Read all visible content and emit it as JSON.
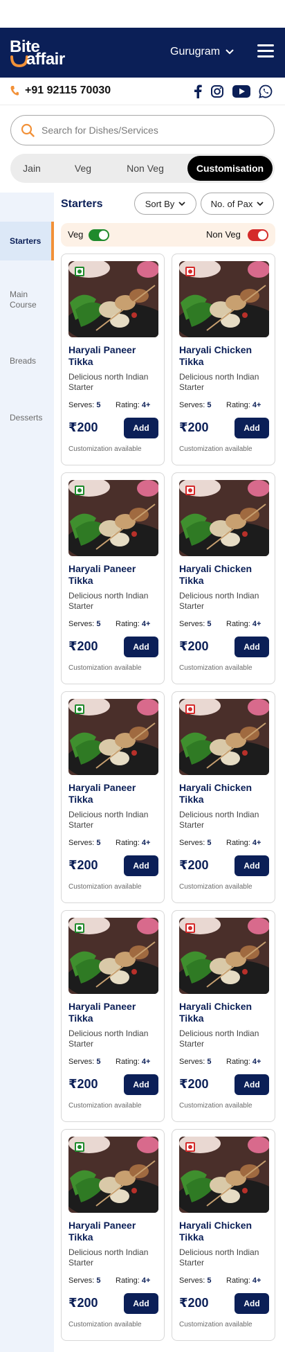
{
  "brand": {
    "line1": "Bite",
    "line2": "affair"
  },
  "header": {
    "city": "Gurugram"
  },
  "contact": {
    "phone": "+91 92115 70030"
  },
  "search": {
    "placeholder": "Search for Dishes/Services"
  },
  "filters": [
    "Jain",
    "Veg",
    "Non Veg",
    "Customisation"
  ],
  "active_filter": "Customisation",
  "sidebar": [
    "Starters",
    "Main Course",
    "Breads",
    "Desserts"
  ],
  "active_category": "Starters",
  "section": {
    "title": "Starters",
    "sort_label": "Sort By",
    "pax_label": "No. of Pax"
  },
  "diet_toggle": {
    "veg_label": "Veg",
    "nonveg_label": "Non Veg",
    "veg_on": true,
    "nonveg_on": true
  },
  "colors": {
    "brand_navy": "#0b1f57",
    "accent_orange": "#f29138",
    "veg_green": "#1f8a2c",
    "nonveg_red": "#d42a2a"
  },
  "cards": [
    {
      "name": "Haryali Paneer Tikka",
      "desc": "Delicious north Indian Starter",
      "serves_label": "Serves:",
      "serves": "5",
      "rating_label": "Rating:",
      "rating": "4+",
      "price": "₹200",
      "add": "Add",
      "note": "Customization available",
      "diet": "veg"
    },
    {
      "name": "Haryali Chicken Tikka",
      "desc": "Delicious north Indian Starter",
      "serves_label": "Serves:",
      "serves": "5",
      "rating_label": "Rating:",
      "rating": "4+",
      "price": "₹200",
      "add": "Add",
      "note": "Customization available",
      "diet": "nonveg"
    },
    {
      "name": "Haryali Paneer Tikka",
      "desc": "Delicious north Indian Starter",
      "serves_label": "Serves:",
      "serves": "5",
      "rating_label": "Rating:",
      "rating": "4+",
      "price": "₹200",
      "add": "Add",
      "note": "Customization available",
      "diet": "veg"
    },
    {
      "name": "Haryali Chicken Tikka",
      "desc": "Delicious north Indian Starter",
      "serves_label": "Serves:",
      "serves": "5",
      "rating_label": "Rating:",
      "rating": "4+",
      "price": "₹200",
      "add": "Add",
      "note": "Customization available",
      "diet": "nonveg"
    },
    {
      "name": "Haryali Paneer Tikka",
      "desc": "Delicious north Indian Starter",
      "serves_label": "Serves:",
      "serves": "5",
      "rating_label": "Rating:",
      "rating": "4+",
      "price": "₹200",
      "add": "Add",
      "note": "Customization available",
      "diet": "veg"
    },
    {
      "name": "Haryali Chicken Tikka",
      "desc": "Delicious north Indian Starter",
      "serves_label": "Serves:",
      "serves": "5",
      "rating_label": "Rating:",
      "rating": "4+",
      "price": "₹200",
      "add": "Add",
      "note": "Customization available",
      "diet": "nonveg"
    },
    {
      "name": "Haryali Paneer Tikka",
      "desc": "Delicious north Indian Starter",
      "serves_label": "Serves:",
      "serves": "5",
      "rating_label": "Rating:",
      "rating": "4+",
      "price": "₹200",
      "add": "Add",
      "note": "Customization available",
      "diet": "veg"
    },
    {
      "name": "Haryali Chicken Tikka",
      "desc": "Delicious north Indian Starter",
      "serves_label": "Serves:",
      "serves": "5",
      "rating_label": "Rating:",
      "rating": "4+",
      "price": "₹200",
      "add": "Add",
      "note": "Customization available",
      "diet": "nonveg"
    },
    {
      "name": "Haryali Paneer Tikka",
      "desc": "Delicious north Indian Starter",
      "serves_label": "Serves:",
      "serves": "5",
      "rating_label": "Rating:",
      "rating": "4+",
      "price": "₹200",
      "add": "Add",
      "note": "Customization available",
      "diet": "veg"
    },
    {
      "name": "Haryali Chicken Tikka",
      "desc": "Delicious north Indian Starter",
      "serves_label": "Serves:",
      "serves": "5",
      "rating_label": "Rating:",
      "rating": "4+",
      "price": "₹200",
      "add": "Add",
      "note": "Customization available",
      "diet": "nonveg"
    }
  ]
}
